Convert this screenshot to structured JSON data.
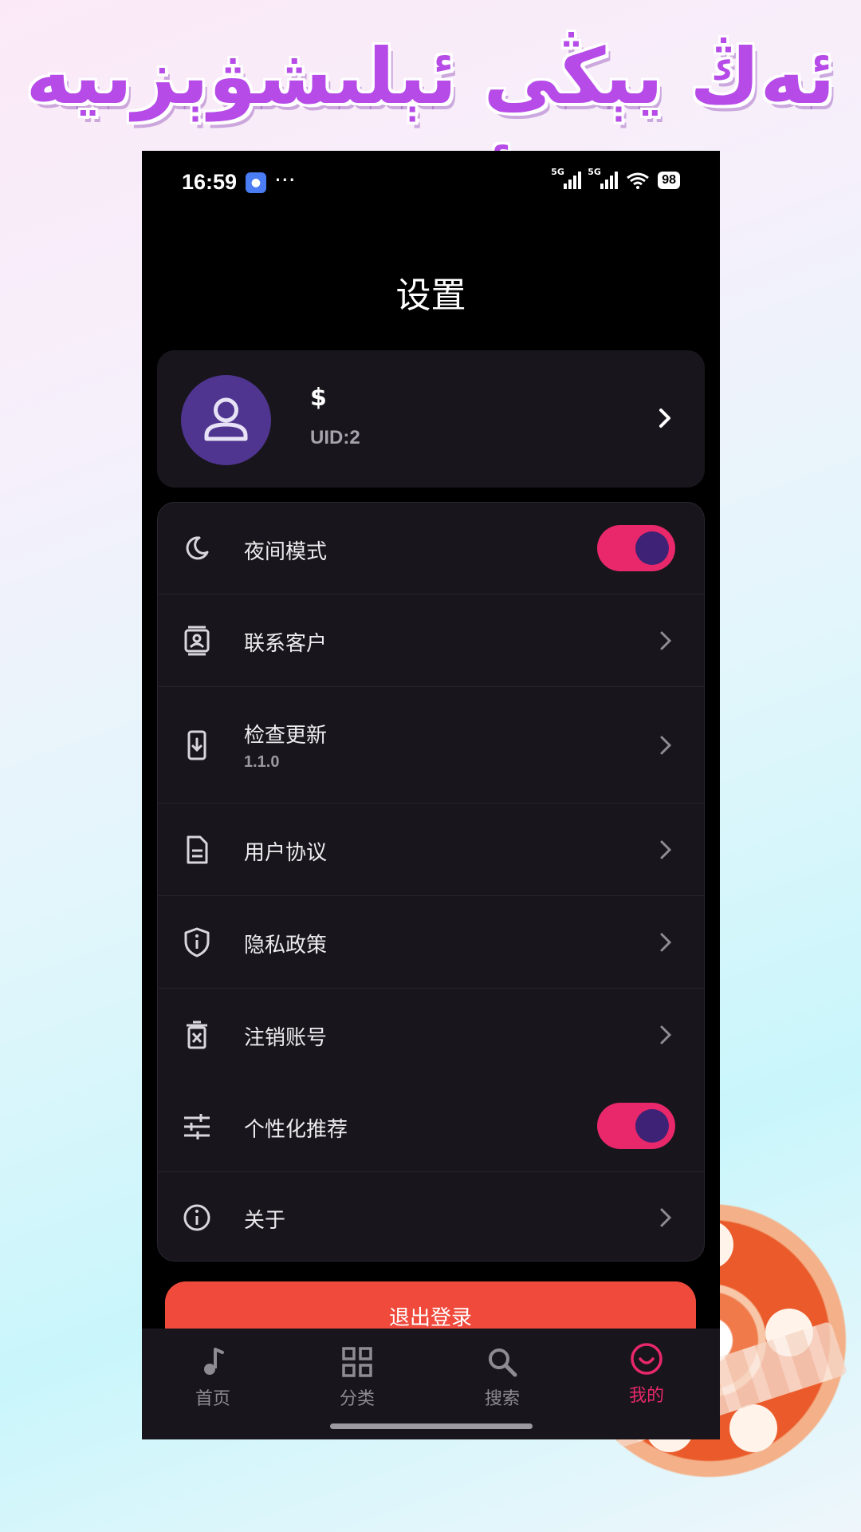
{
  "promo": {
    "title": "ئەڭ يېڭى ئېلىشۋېزىيە ئېپى"
  },
  "status_bar": {
    "time": "16:59",
    "app_icon": "baidu-paw-icon",
    "more": "···",
    "network1": "5G",
    "network2": "5G",
    "battery": "98"
  },
  "page": {
    "title": "设置"
  },
  "profile": {
    "name": "$",
    "uid": "UID:2",
    "avatar_icon": "person-icon"
  },
  "settings": {
    "night_mode": {
      "label": "夜间模式",
      "icon": "moon-icon",
      "enabled": true
    },
    "contact": {
      "label": "联系客户",
      "icon": "contact-card-icon"
    },
    "check_update": {
      "label": "检查更新",
      "version": "1.1.0",
      "icon": "phone-download-icon"
    },
    "user_agreement": {
      "label": "用户协议",
      "icon": "document-icon"
    },
    "privacy_policy": {
      "label": "隐私政策",
      "icon": "shield-info-icon"
    },
    "delete_account": {
      "label": "注销账号",
      "icon": "trash-icon"
    },
    "personalized": {
      "label": "个性化推荐",
      "icon": "sliders-icon",
      "enabled": true
    },
    "about": {
      "label": "关于",
      "icon": "info-icon"
    }
  },
  "logout": {
    "label": "退出登录"
  },
  "tabs": [
    {
      "label": "首页",
      "icon": "music-note-icon"
    },
    {
      "label": "分类",
      "icon": "grid-icon"
    },
    {
      "label": "搜索",
      "icon": "search-icon"
    },
    {
      "label": "我的",
      "icon": "smile-icon",
      "active": true
    }
  ],
  "colors": {
    "accent": "#e8286a",
    "knob": "#3e2275",
    "card": "#18161c",
    "logout": "#ef4a3b",
    "avatar": "#4f3590"
  }
}
